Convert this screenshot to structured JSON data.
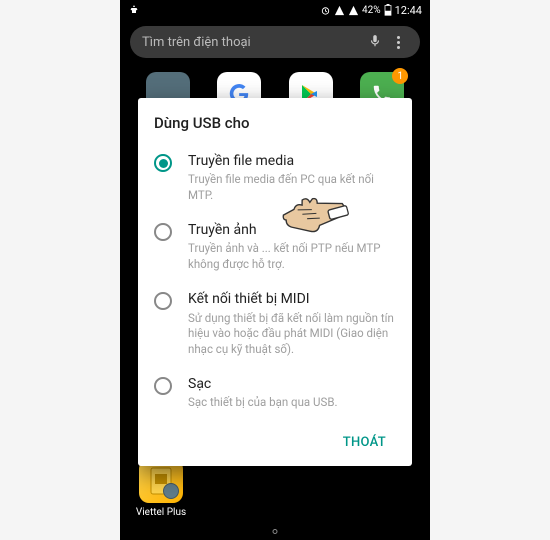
{
  "status": {
    "battery": "42%",
    "time": "12:44"
  },
  "search": {
    "placeholder": "Tìm trên điện thoại"
  },
  "apps": {
    "phone_badge": "1"
  },
  "dialog": {
    "title": "Dùng USB cho",
    "options": [
      {
        "label": "Truyền file media",
        "desc": "Truyền file media đến PC qua kết nối MTP.",
        "selected": true
      },
      {
        "label": "Truyền ảnh",
        "desc": "Truyền ảnh và ... kết nối PTP nếu MTP không được hỗ trợ.",
        "selected": false
      },
      {
        "label": "Kết nối thiết bị MIDI",
        "desc": "Sử dụng thiết bị đã kết nối làm nguồn tín hiệu vào hoặc đầu phát MIDI (Giao diện nhạc cụ kỹ thuật số).",
        "selected": false
      },
      {
        "label": "Sạc",
        "desc": "Sạc thiết bị của bạn qua USB.",
        "selected": false
      }
    ],
    "exit_label": "THOÁT"
  },
  "bottom_app": {
    "label": "Viettel Plus"
  }
}
